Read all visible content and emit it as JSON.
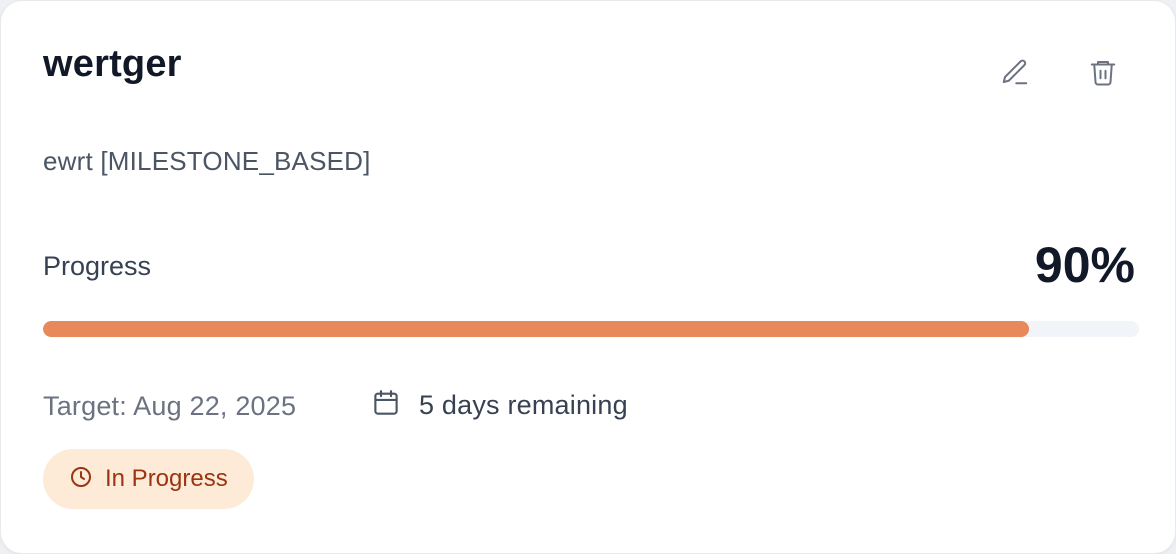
{
  "goal": {
    "title": "wertger",
    "description": "ewrt [MILESTONE_BASED]",
    "progress_label": "Progress",
    "progress_value_text": "90%",
    "progress_fraction": 0.9,
    "target_text": "Target: Aug 22, 2025",
    "remaining_text": "5 days remaining",
    "status_text": "In Progress"
  },
  "icons": {
    "edit": "pencil-icon",
    "delete": "trash-icon",
    "calendar": "calendar-icon",
    "status": "clock-icon"
  },
  "colors": {
    "progress_fill": "#e8895b",
    "progress_track": "#f1f4f8",
    "badge_bg": "#fdebd8",
    "badge_text": "#9a3412"
  }
}
